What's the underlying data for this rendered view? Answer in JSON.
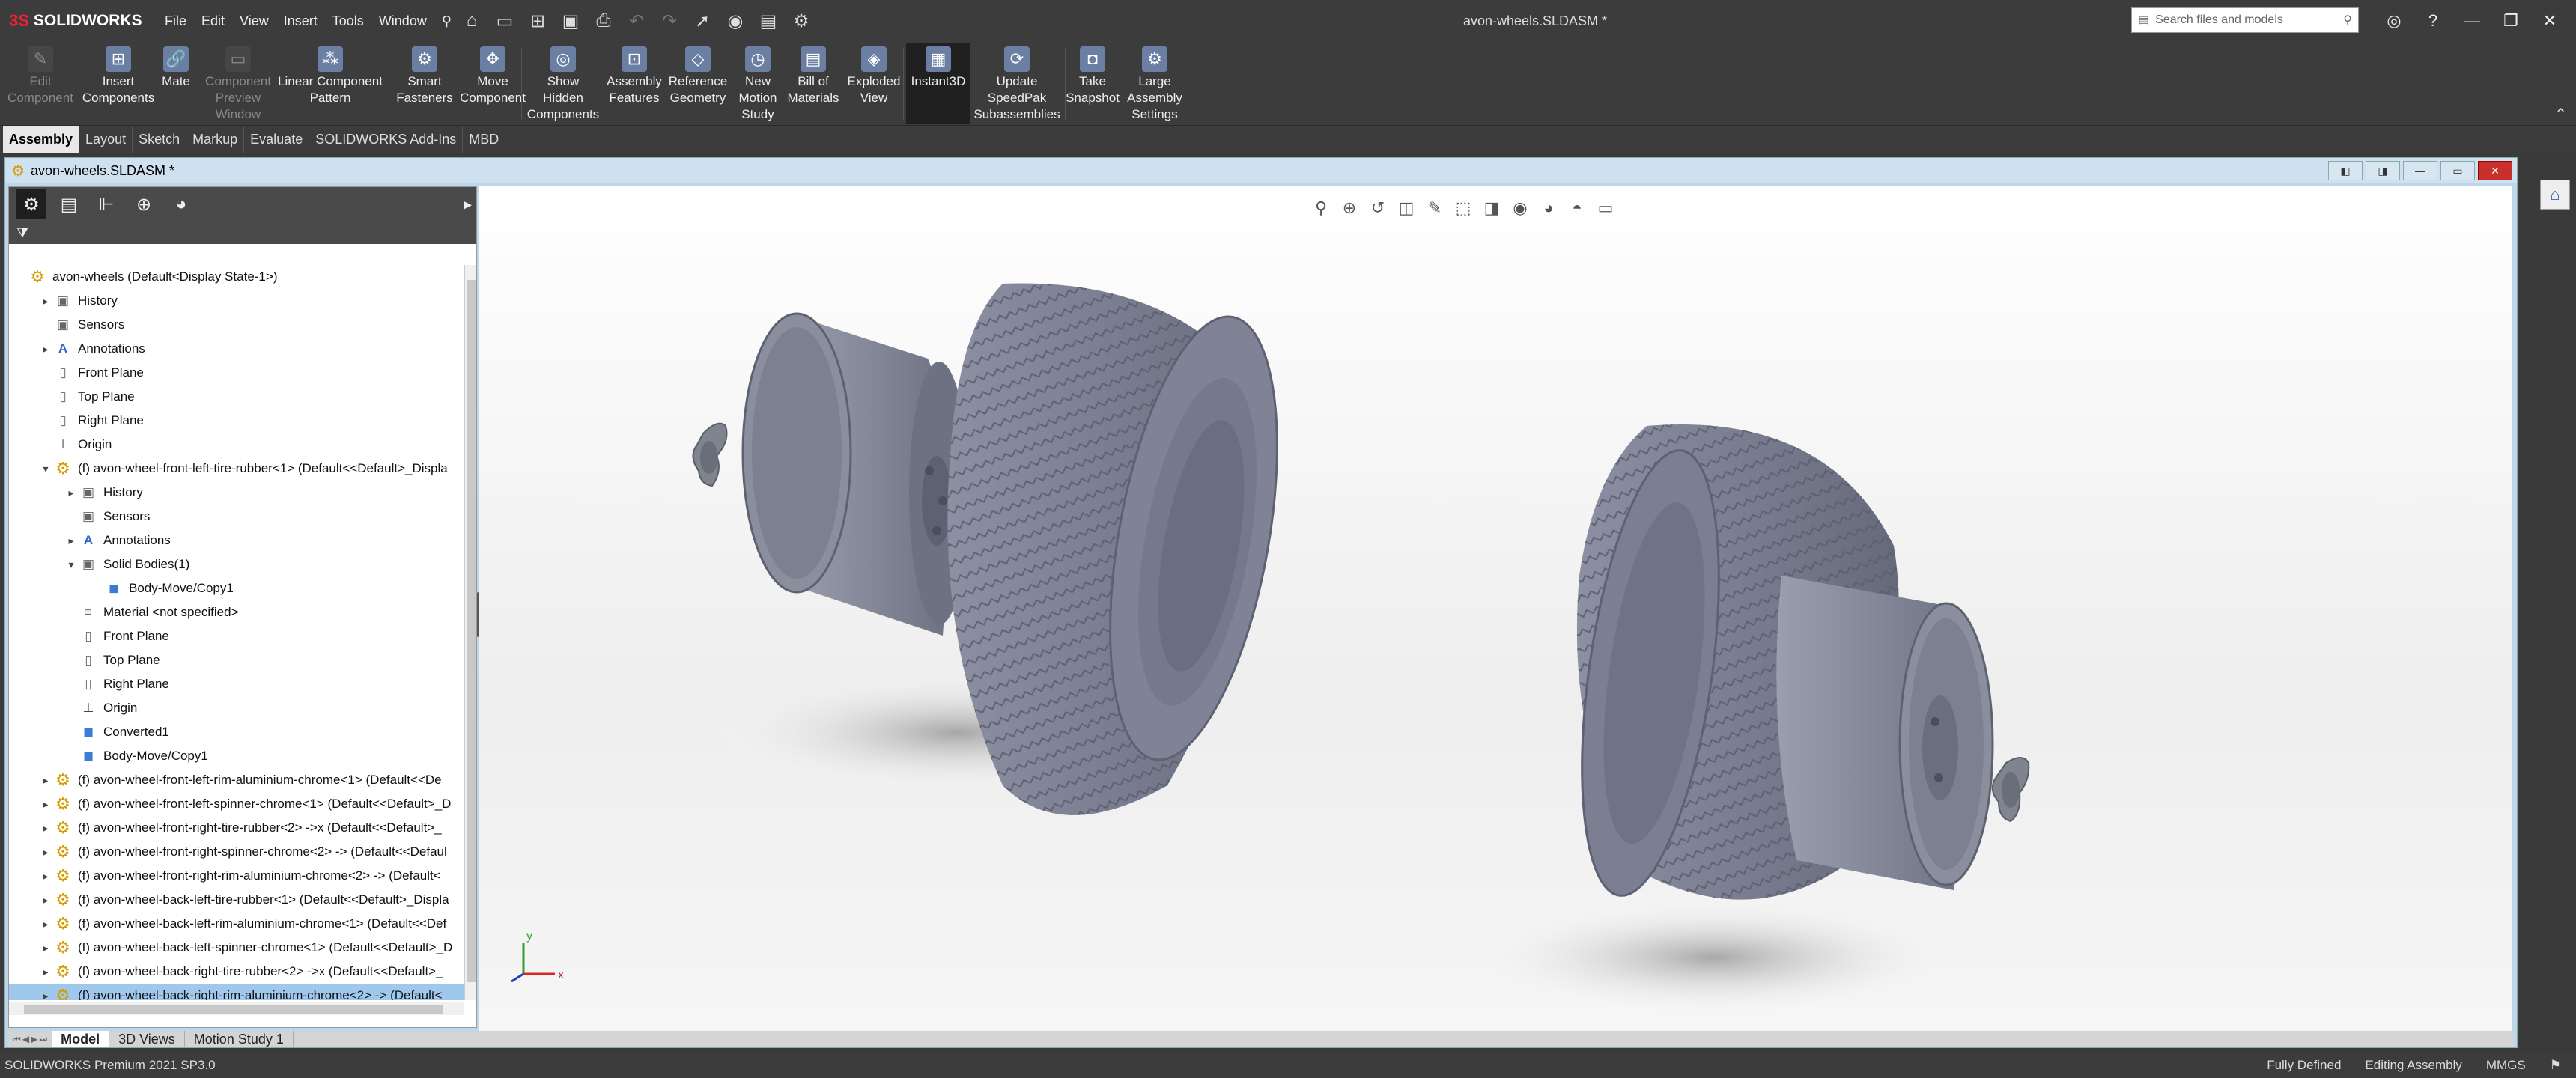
{
  "app": {
    "brand": "SOLIDWORKS",
    "window_title": "avon-wheels.SLDASM *"
  },
  "menu": [
    "File",
    "Edit",
    "View",
    "Insert",
    "Tools",
    "Window"
  ],
  "search": {
    "placeholder": "Search files and models"
  },
  "ribbon": {
    "buttons": [
      {
        "label": "Edit\nComponent",
        "icon": "edit-component-icon",
        "disabled": true
      },
      {
        "label": "Insert\nComponents",
        "icon": "insert-components-icon",
        "disabled": false
      },
      {
        "label": "Mate",
        "icon": "mate-icon",
        "disabled": false
      },
      {
        "label": "Component\nPreview\nWindow",
        "icon": "component-preview-icon",
        "disabled": true
      },
      {
        "label": "Linear Component\nPattern",
        "icon": "linear-pattern-icon",
        "disabled": false
      },
      {
        "label": "Smart\nFasteners",
        "icon": "smart-fasteners-icon",
        "disabled": false
      },
      {
        "label": "Move\nComponent",
        "icon": "move-component-icon",
        "disabled": false
      },
      {
        "label": "Show\nHidden\nComponents",
        "icon": "show-hidden-icon",
        "disabled": false
      },
      {
        "label": "Assembly\nFeatures",
        "icon": "assembly-features-icon",
        "disabled": false
      },
      {
        "label": "Reference\nGeometry",
        "icon": "reference-geometry-icon",
        "disabled": false
      },
      {
        "label": "New\nMotion\nStudy",
        "icon": "motion-study-icon",
        "disabled": false
      },
      {
        "label": "Bill of\nMaterials",
        "icon": "bom-icon",
        "disabled": false
      },
      {
        "label": "Exploded\nView",
        "icon": "exploded-view-icon",
        "disabled": false
      },
      {
        "label": "Instant3D",
        "icon": "instant3d-icon",
        "disabled": false
      },
      {
        "label": "Update\nSpeedPak\nSubassemblies",
        "icon": "speedpak-icon",
        "disabled": false
      },
      {
        "label": "Take\nSnapshot",
        "icon": "snapshot-icon",
        "disabled": false
      },
      {
        "label": "Large\nAssembly\nSettings",
        "icon": "large-assembly-icon",
        "disabled": false
      }
    ]
  },
  "command_tabs": [
    "Assembly",
    "Layout",
    "Sketch",
    "Markup",
    "Evaluate",
    "SOLIDWORKS Add-Ins",
    "MBD"
  ],
  "document": {
    "title": "avon-wheels.SLDASM *"
  },
  "feature_tree": [
    {
      "label": "avon-wheels  (Default<Display State-1>)",
      "icon": "assembly",
      "toggle": "",
      "indent": 0
    },
    {
      "label": "History",
      "icon": "folder",
      "toggle": "▸",
      "indent": 1
    },
    {
      "label": "Sensors",
      "icon": "folder",
      "toggle": "",
      "indent": 1
    },
    {
      "label": "Annotations",
      "icon": "ann",
      "toggle": "▸",
      "indent": 1
    },
    {
      "label": "Front Plane",
      "icon": "plane",
      "toggle": "",
      "indent": 1
    },
    {
      "label": "Top Plane",
      "icon": "plane",
      "toggle": "",
      "indent": 1
    },
    {
      "label": "Right Plane",
      "icon": "plane",
      "toggle": "",
      "indent": 1
    },
    {
      "label": "Origin",
      "icon": "origin",
      "toggle": "",
      "indent": 1
    },
    {
      "label": "(f) avon-wheel-front-left-tire-rubber<1> (Default<<Default>_Displa",
      "icon": "part",
      "toggle": "▾",
      "indent": 1
    },
    {
      "label": "History",
      "icon": "folder",
      "toggle": "▸",
      "indent": 2
    },
    {
      "label": "Sensors",
      "icon": "folder",
      "toggle": "",
      "indent": 2
    },
    {
      "label": "Annotations",
      "icon": "ann",
      "toggle": "▸",
      "indent": 2
    },
    {
      "label": "Solid Bodies(1)",
      "icon": "folder",
      "toggle": "▾",
      "indent": 2
    },
    {
      "label": "Body-Move/Copy1",
      "icon": "body",
      "toggle": "",
      "indent": 3
    },
    {
      "label": "Material <not specified>",
      "icon": "mat",
      "toggle": "",
      "indent": 2
    },
    {
      "label": "Front Plane",
      "icon": "plane",
      "toggle": "",
      "indent": 2
    },
    {
      "label": "Top Plane",
      "icon": "plane",
      "toggle": "",
      "indent": 2
    },
    {
      "label": "Right Plane",
      "icon": "plane",
      "toggle": "",
      "indent": 2
    },
    {
      "label": "Origin",
      "icon": "origin",
      "toggle": "",
      "indent": 2
    },
    {
      "label": "Converted1",
      "icon": "body",
      "toggle": "",
      "indent": 2
    },
    {
      "label": "Body-Move/Copy1",
      "icon": "body",
      "toggle": "",
      "indent": 2
    },
    {
      "label": "(f) avon-wheel-front-left-rim-aluminium-chrome<1> (Default<<De",
      "icon": "part",
      "toggle": "▸",
      "indent": 1
    },
    {
      "label": "(f) avon-wheel-front-left-spinner-chrome<1> (Default<<Default>_D",
      "icon": "part",
      "toggle": "▸",
      "indent": 1
    },
    {
      "label": "(f) avon-wheel-front-right-tire-rubber<2> ->x (Default<<Default>_",
      "icon": "part",
      "toggle": "▸",
      "indent": 1
    },
    {
      "label": "(f) avon-wheel-front-right-spinner-chrome<2> -> (Default<<Defaul",
      "icon": "part",
      "toggle": "▸",
      "indent": 1
    },
    {
      "label": "(f) avon-wheel-front-right-rim-aluminium-chrome<2> -> (Default<",
      "icon": "part",
      "toggle": "▸",
      "indent": 1
    },
    {
      "label": "(f) avon-wheel-back-left-tire-rubber<1> (Default<<Default>_Displa",
      "icon": "part",
      "toggle": "▸",
      "indent": 1
    },
    {
      "label": "(f) avon-wheel-back-left-rim-aluminium-chrome<1> (Default<<Def",
      "icon": "part",
      "toggle": "▸",
      "indent": 1
    },
    {
      "label": "(f) avon-wheel-back-left-spinner-chrome<1> (Default<<Default>_D",
      "icon": "part",
      "toggle": "▸",
      "indent": 1
    },
    {
      "label": "(f) avon-wheel-back-right-tire-rubber<2> ->x (Default<<Default>_",
      "icon": "part",
      "toggle": "▸",
      "indent": 1
    },
    {
      "label": "(f) avon-wheel-back-right-rim-aluminium-chrome<2> -> (Default<",
      "icon": "part",
      "toggle": "▸",
      "indent": 1,
      "selected": true
    }
  ],
  "bottom_tabs": [
    "Model",
    "3D Views",
    "Motion Study 1"
  ],
  "status": {
    "product": "SOLIDWORKS Premium 2021 SP3.0",
    "state": "Fully Defined",
    "mode": "Editing Assembly",
    "units": "MMGS"
  },
  "triad": {
    "x": "x",
    "y": "y"
  },
  "colors": {
    "background": "#3c3c3c",
    "tree_selected": "#9fc8ec",
    "part_icon": "#d69b00",
    "model_gray": "#7e8294"
  }
}
